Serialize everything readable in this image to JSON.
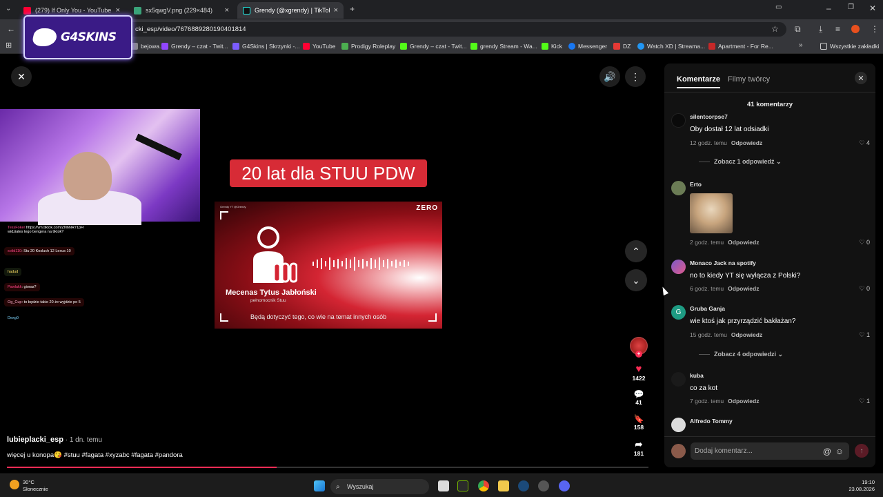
{
  "browser": {
    "tabs": [
      {
        "title": "(279) If Only You - YouTube",
        "color": "#ff0033"
      },
      {
        "title": "sx5qwgV.png (229×484)",
        "color": "#3aa37a"
      },
      {
        "title": "Grendy (@xgrendy) | TikTok",
        "color": "#222222"
      }
    ],
    "url": "cki_esp/video/7676889280190401814",
    "bookmarks": [
      {
        "label": "bejowa...",
        "color": "#888888"
      },
      {
        "label": "Grendy – czat - Twit...",
        "color": "#9146ff"
      },
      {
        "label": "G4Skins | Skrzynki -...",
        "color": "#7b5cff"
      },
      {
        "label": "YouTube",
        "color": "#ff0033"
      },
      {
        "label": "Prodigy Roleplay",
        "color": "#4caf50"
      },
      {
        "label": "Grendy – czat - Twit...",
        "color": "#53fc18"
      },
      {
        "label": "grendy Stream - Wa...",
        "color": "#53fc18"
      },
      {
        "label": "Kick",
        "color": "#53fc18"
      },
      {
        "label": "Messenger",
        "color": "#1877f2"
      },
      {
        "label": "DZ",
        "color": "#e53935"
      },
      {
        "label": "Watch XD | Streama...",
        "color": "#2196f3"
      },
      {
        "label": "Apartment - For Re...",
        "color": "#c62828"
      }
    ],
    "all_bookmarks": "Wszystkie zakładki"
  },
  "overlay": {
    "logo_text": "G4SKINS"
  },
  "stream_chat": [
    {
      "user": "TessFoker",
      "text": "https://vm.tiktok.com/ZN6NR71pF/ widziales tego bengera na tiktok?"
    },
    {
      "user": "solid110",
      "text": "Stu 20 Kosluch 12 Lexus 10"
    },
    {
      "user": "hadud",
      "text": ""
    },
    {
      "user": "Pawlakk",
      "text": "gioras?"
    },
    {
      "user": "Og_Cup",
      "text": "to będzie takie 20 że wyjdzie po 5"
    },
    {
      "user": "Dexg0",
      "text": ""
    }
  ],
  "video": {
    "caption": "20 lat dla STUU PDW",
    "brand": "ZERO",
    "small_label": "Grendy YT @Grendy",
    "person_name": "Mecenas Tytus Jabłoński",
    "person_role": "pełnomocnik Stuu",
    "subtitle": "Będą dotyczyć tego, co wie na temat innych osób",
    "progress": 0.42
  },
  "post": {
    "author": "lubieplacki_esp",
    "time": " · 1 dn. temu",
    "description": "więcej u konopa😘 #stuu #fagata #xyzabc #fagata #pandora"
  },
  "rail": {
    "likes": "1422",
    "comments": "41",
    "saves": "158",
    "shares": "181"
  },
  "comments_panel": {
    "tab_comments": "Komentarze",
    "tab_creator": "Filmy twórcy",
    "count_label": "41 komentarzy",
    "reply_label": "Odpowiedz",
    "input_placeholder": "Dodaj komentarz...",
    "comments": [
      {
        "user": "silentcorpse7",
        "text": "Oby dostał 12 lat odsiadki",
        "time": "12 godz. temu",
        "likes": "4",
        "avatar_color": "#0a0a0a",
        "more_replies": "Zobacz 1 odpowiedź"
      },
      {
        "user": "Erto",
        "text": "",
        "time": "2 godz. temu",
        "likes": "0",
        "avatar_color": "#6b7c55",
        "more_replies": ""
      },
      {
        "user": "Monaco Jack na spotify",
        "text": "no to kiedy YT się wyłącza z Polski?",
        "time": "6 godz. temu",
        "likes": "0",
        "avatar_color": "#7a5ac8",
        "more_replies": ""
      },
      {
        "user": "Gruba Ganja",
        "text": "wie ktoś jak przyrządzić bakłażan?",
        "time": "15 godz. temu",
        "likes": "1",
        "avatar_color": "#1e9c83",
        "avatar_letter": "G",
        "more_replies": "Zobacz 4 odpowiedzi"
      },
      {
        "user": "kuba",
        "text": "co za kot",
        "time": "7 godz. temu",
        "likes": "1",
        "avatar_color": "#1a1a1a",
        "more_replies": ""
      },
      {
        "user": "Alfredo Tommy",
        "text": "",
        "time": "",
        "likes": "",
        "avatar_color": "#dcdcdc",
        "more_replies": ""
      }
    ]
  },
  "taskbar": {
    "temp": "30°C",
    "weather": "Słonecznie",
    "search_placeholder": "Wyszukaj",
    "time": "19:10",
    "date": "23.08.2026"
  }
}
